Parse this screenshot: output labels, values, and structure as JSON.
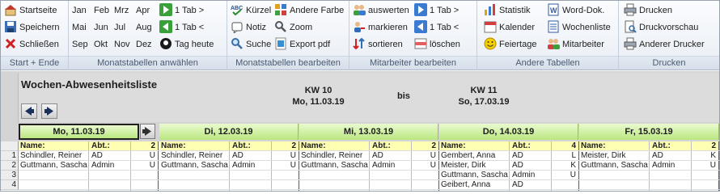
{
  "ribbon": {
    "start_ende": {
      "label": "Start + Ende",
      "startseite": "Startseite",
      "speichern": "Speichern",
      "schliessen": "Schließen"
    },
    "monate": {
      "label": "Monatstabellen anwählen",
      "months": [
        "Jan",
        "Feb",
        "Mrz",
        "Apr",
        "Mai",
        "Jun",
        "Jul",
        "Aug",
        "Sep",
        "Okt",
        "Nov",
        "Dez"
      ],
      "tab_fwd": "1 Tab >",
      "tab_back": "1 Tab <",
      "tag_heute": "Tag heute"
    },
    "bearbeiten": {
      "label": "Monatstabellen bearbeiten",
      "kuerzel": "Kürzel",
      "andere_farbe": "Andere Farbe",
      "notiz": "Notiz",
      "zoom": "Zoom",
      "suche": "Suche",
      "export_pdf": "Export pdf"
    },
    "mitarbeiter": {
      "label": "Mitarbeiter bearbeiten",
      "auswerten": "auswerten",
      "markieren": "markieren",
      "sortieren": "sortieren",
      "tab_fwd": "1 Tab >",
      "tab_back": "1 Tab <",
      "loeschen": "löschen"
    },
    "tabellen": {
      "label": "Andere Tabellen",
      "statistik": "Statistik",
      "kalender": "Kalender",
      "feiertage": "Feiertage",
      "word_dok": "Word-Dok.",
      "wochenliste": "Wochenliste",
      "mitarbeiter": "Mitarbeiter"
    },
    "drucken": {
      "label": "Drucken",
      "drucken": "Drucken",
      "druckvorschau": "Druckvorschau",
      "anderer_drucker": "Anderer Drucker"
    }
  },
  "sheet": {
    "title": "Wochen-Abwesenheitsliste",
    "kw_start": "KW 10",
    "date_start": "Mo, 11.03.19",
    "bis": "bis",
    "kw_end": "KW 11",
    "date_end": "So, 17.03.19"
  },
  "days": [
    {
      "label": "Mo, 11.03.19",
      "count": "2",
      "rows": [
        [
          "Schindler, Reiner",
          "AD",
          "U"
        ],
        [
          "Guttmann, Sascha",
          "Admin",
          "U"
        ],
        [
          "",
          "",
          ""
        ],
        [
          "",
          "",
          ""
        ]
      ]
    },
    {
      "label": "Di, 12.03.19",
      "count": "2",
      "rows": [
        [
          "Schindler, Reiner",
          "AD",
          "U"
        ],
        [
          "Guttmann, Sascha",
          "Admin",
          "U"
        ],
        [
          "",
          "",
          ""
        ],
        [
          "",
          "",
          ""
        ]
      ]
    },
    {
      "label": "Mi, 13.03.19",
      "count": "2",
      "rows": [
        [
          "Schindler, Reiner",
          "AD",
          "U"
        ],
        [
          "Guttmann, Sascha",
          "Admin",
          "U"
        ],
        [
          "",
          "",
          ""
        ],
        [
          "",
          "",
          ""
        ]
      ]
    },
    {
      "label": "Do, 14.03.19",
      "count": "4",
      "rows": [
        [
          "Gembert, Anna",
          "AD",
          "L"
        ],
        [
          "Meister, Dirk",
          "AD",
          "K"
        ],
        [
          "Guttmann, Sascha",
          "Admin",
          "U"
        ],
        [
          "Geibert, Anna",
          "AD",
          ""
        ]
      ]
    },
    {
      "label": "Fr, 15.03.19",
      "count": "2",
      "rows": [
        [
          "Meister, Dirk",
          "AD",
          "K"
        ],
        [
          "Guttmann, Sascha",
          "Admin",
          "U"
        ],
        [
          "",
          "",
          ""
        ],
        [
          "",
          "",
          ""
        ]
      ]
    }
  ],
  "columns": {
    "name": "Name:",
    "abt": "Abt.:"
  },
  "row_numbers": [
    "1",
    "2",
    "3",
    "4"
  ]
}
